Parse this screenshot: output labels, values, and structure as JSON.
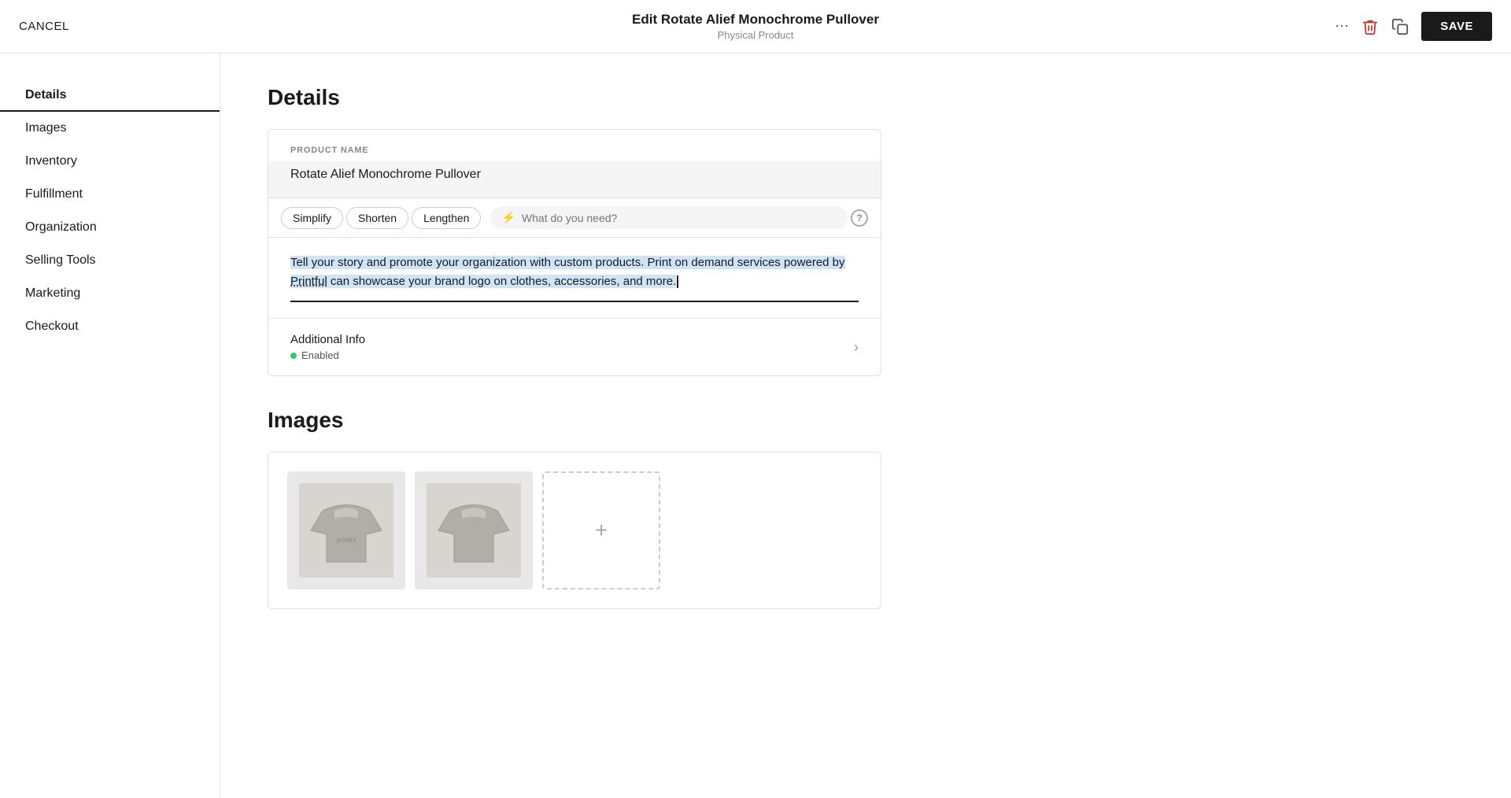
{
  "topbar": {
    "cancel_label": "CANCEL",
    "title": "Edit Rotate Alief Monochrome Pullover",
    "subtitle": "Physical Product",
    "save_label": "SAVE",
    "more_icon": "more-horizontal",
    "delete_icon": "trash",
    "duplicate_icon": "copy"
  },
  "sidebar": {
    "items": [
      {
        "label": "Details",
        "active": true
      },
      {
        "label": "Images",
        "active": false
      },
      {
        "label": "Inventory",
        "active": false
      },
      {
        "label": "Fulfillment",
        "active": false
      },
      {
        "label": "Organization",
        "active": false
      },
      {
        "label": "Selling Tools",
        "active": false
      },
      {
        "label": "Marketing",
        "active": false
      },
      {
        "label": "Checkout",
        "active": false
      }
    ]
  },
  "main": {
    "details_title": "Details",
    "images_title": "Images",
    "product_name_label": "PRODUCT NAME",
    "product_name_value": "Rotate Alief Monochrome Pullover",
    "ai_toolbar": {
      "simplify_label": "Simplify",
      "shorten_label": "Shorten",
      "lengthen_label": "Lengthen",
      "search_placeholder": "What do you need?"
    },
    "description_text": "Tell your story and promote your organization with custom products. Print on demand services powered by Printful can showcase your brand logo on clothes, accessories, and more.",
    "additional_info_title": "Additional Info",
    "additional_info_status": "Enabled"
  }
}
